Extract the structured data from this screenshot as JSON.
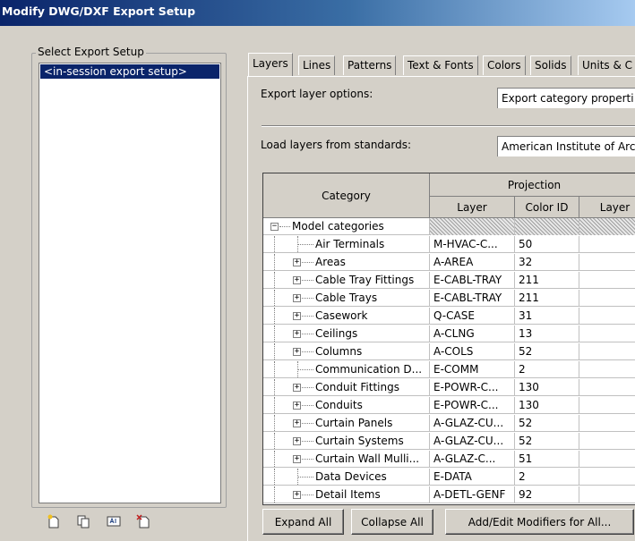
{
  "window": {
    "title": "Modify DWG/DXF Export Setup"
  },
  "left_panel": {
    "group_label": "Select Export Setup",
    "setups": [
      "<in-session export setup>"
    ],
    "toolbar": [
      {
        "icon": "new-setup-icon"
      },
      {
        "icon": "duplicate-setup-icon"
      },
      {
        "icon": "rename-setup-icon"
      },
      {
        "icon": "delete-setup-icon"
      }
    ]
  },
  "tabs": [
    "Layers",
    "Lines",
    "Patterns",
    "Text & Fonts",
    "Colors",
    "Solids",
    "Units & C"
  ],
  "active_tab": "Layers",
  "layers_tab": {
    "export_layer_options_label": "Export layer options:",
    "export_layer_options_value": "Export category properti",
    "load_layers_label": "Load layers from standards:",
    "load_layers_value": "American Institute of Arc",
    "grid": {
      "category_header": "Category",
      "projection_header": "Projection",
      "columns": [
        "Layer",
        "Color ID",
        "Layer"
      ],
      "rows": [
        {
          "category": "Model categories",
          "expander": "−",
          "level": 0,
          "layer": "",
          "color_id": "",
          "hatched": true
        },
        {
          "category": "Air Terminals",
          "expander": "",
          "level": 1,
          "layer": "M-HVAC-C...",
          "color_id": "50"
        },
        {
          "category": "Areas",
          "expander": "+",
          "level": 1,
          "layer": "A-AREA",
          "color_id": "32"
        },
        {
          "category": "Cable Tray Fittings",
          "expander": "+",
          "level": 1,
          "layer": "E-CABL-TRAY",
          "color_id": "211"
        },
        {
          "category": "Cable Trays",
          "expander": "+",
          "level": 1,
          "layer": "E-CABL-TRAY",
          "color_id": "211"
        },
        {
          "category": "Casework",
          "expander": "+",
          "level": 1,
          "layer": "Q-CASE",
          "color_id": "31"
        },
        {
          "category": "Ceilings",
          "expander": "+",
          "level": 1,
          "layer": "A-CLNG",
          "color_id": "13"
        },
        {
          "category": "Columns",
          "expander": "+",
          "level": 1,
          "layer": "A-COLS",
          "color_id": "52"
        },
        {
          "category": "Communication D...",
          "expander": "",
          "level": 1,
          "layer": "E-COMM",
          "color_id": "2"
        },
        {
          "category": "Conduit Fittings",
          "expander": "+",
          "level": 1,
          "layer": "E-POWR-C...",
          "color_id": "130"
        },
        {
          "category": "Conduits",
          "expander": "+",
          "level": 1,
          "layer": "E-POWR-C...",
          "color_id": "130"
        },
        {
          "category": "Curtain Panels",
          "expander": "+",
          "level": 1,
          "layer": "A-GLAZ-CU...",
          "color_id": "52"
        },
        {
          "category": "Curtain Systems",
          "expander": "+",
          "level": 1,
          "layer": "A-GLAZ-CU...",
          "color_id": "52"
        },
        {
          "category": "Curtain Wall Mulli...",
          "expander": "+",
          "level": 1,
          "layer": "A-GLAZ-C...",
          "color_id": "51"
        },
        {
          "category": "Data Devices",
          "expander": "",
          "level": 1,
          "layer": "E-DATA",
          "color_id": "2"
        },
        {
          "category": "Detail Items",
          "expander": "+",
          "level": 1,
          "layer": "A-DETL-GENF",
          "color_id": "92"
        }
      ]
    },
    "buttons": {
      "expand_all": "Expand All",
      "collapse_all": "Collapse All",
      "add_edit_modifiers": "Add/Edit Modifiers for All..."
    }
  },
  "colors": {
    "title_start": "#0a246a",
    "title_end": "#a6caf0",
    "selection": "#0a246a",
    "dialog_bg": "#d4d0c8"
  }
}
